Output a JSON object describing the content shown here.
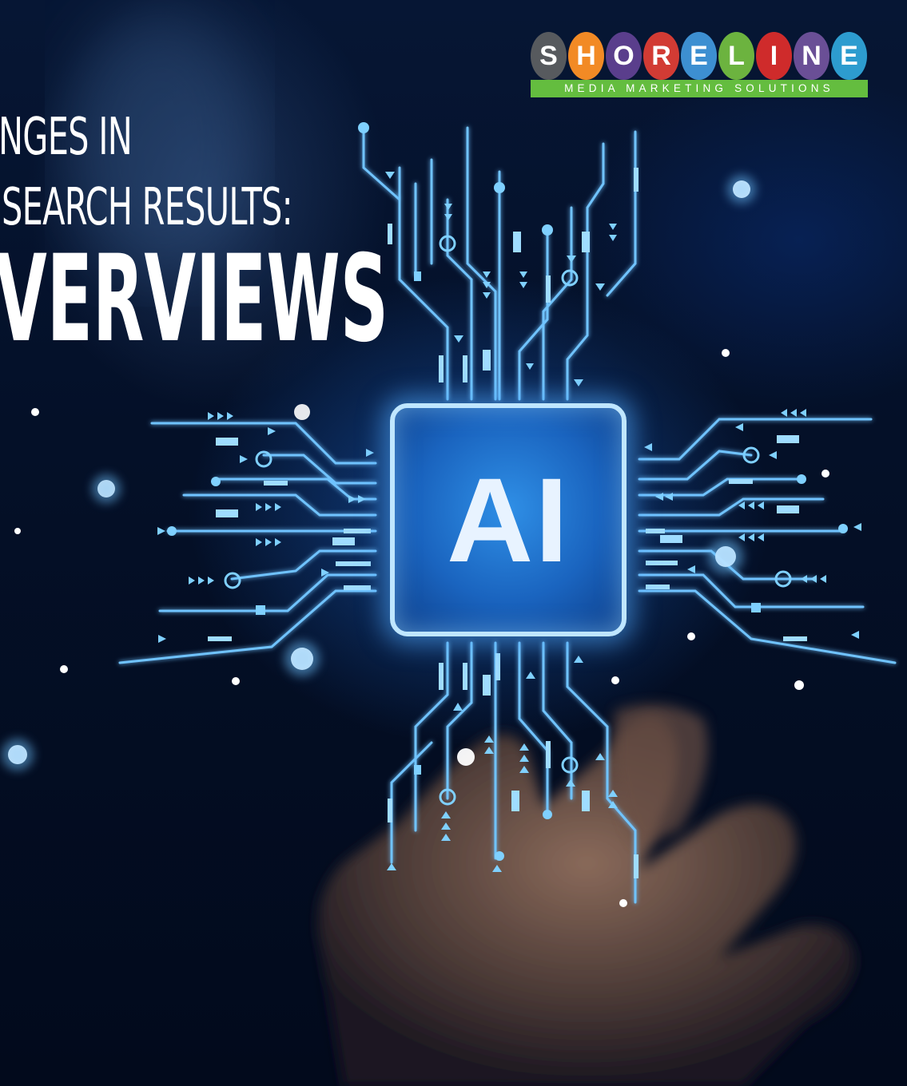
{
  "headline": {
    "line1": "NGES IN",
    "line2": "SEARCH RESULTS:",
    "line3": "VERVIEWS"
  },
  "logo": {
    "letters": [
      {
        "char": "S",
        "color": "#575a5e"
      },
      {
        "char": "H",
        "color": "#f28a25"
      },
      {
        "char": "O",
        "color": "#5a3e8c"
      },
      {
        "char": "R",
        "color": "#d23b34"
      },
      {
        "char": "E",
        "color": "#3d8fd1"
      },
      {
        "char": "L",
        "color": "#6cb33f"
      },
      {
        "char": "I",
        "color": "#cf2b2b"
      },
      {
        "char": "N",
        "color": "#6a4f96"
      },
      {
        "char": "E",
        "color": "#2d9ccf"
      }
    ],
    "tagline": "MEDIA MARKETING SOLUTIONS",
    "tagline_color": "#64bd3f"
  },
  "chip": {
    "label": "AI"
  },
  "colors": {
    "background": "#020b1f",
    "circuit_glow": "#6fc3ff",
    "chip_border": "#bfe6ff"
  }
}
